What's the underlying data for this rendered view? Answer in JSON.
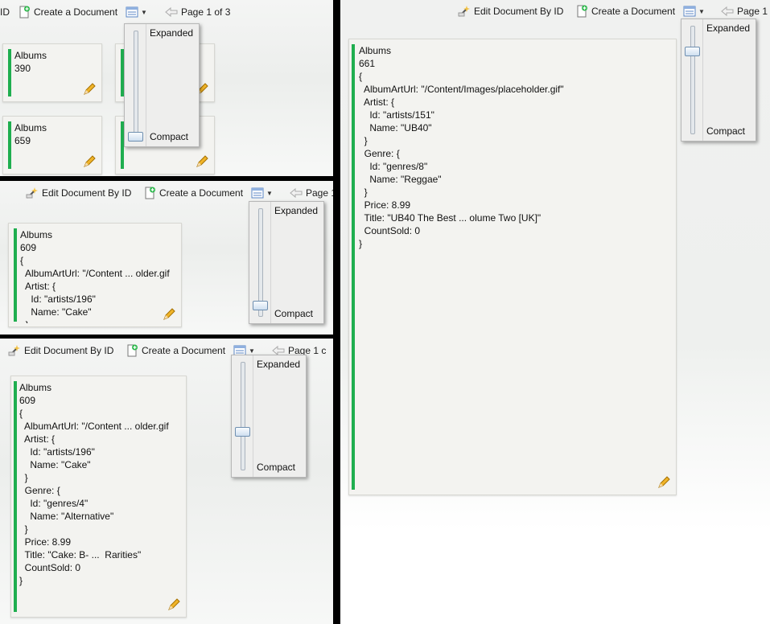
{
  "toolbar": {
    "edit_label": "Edit Document By ID",
    "edit_label_cut": "ID",
    "create_label": "Create a Document",
    "page_label_full": "Page 1 of 3",
    "page_label_1": "Page 1",
    "page_label_2": "Page 1 c"
  },
  "density": {
    "top": "Expanded",
    "bottom": "Compact"
  },
  "icons": {
    "edit": "wand-icon",
    "create": "new-document-icon",
    "view": "list-view-icon",
    "prev": "back-arrow-icon",
    "card_edit": "pencil-icon"
  },
  "colors": {
    "card_bar": "#1fae4f",
    "card_bg": "#f3f3f0"
  },
  "panel_a": {
    "cards": [
      {
        "collection": "Albums",
        "id": "390"
      },
      {
        "collection": "Albums",
        "id": "659"
      }
    ]
  },
  "panel_b": {
    "collection": "Albums",
    "id": "609",
    "lines": [
      "{",
      "  AlbumArtUrl: \"/Content ... older.gif",
      "  Artist: {",
      "    Id: \"artists/196\"",
      "    Name: \"Cake\"",
      "  }"
    ]
  },
  "panel_c": {
    "collection": "Albums",
    "id": "609",
    "lines": [
      "{",
      "  AlbumArtUrl: \"/Content ... older.gif",
      "  Artist: {",
      "    Id: \"artists/196\"",
      "    Name: \"Cake\"",
      "  }",
      "  Genre: {",
      "    Id: \"genres/4\"",
      "    Name: \"Alternative\"",
      "  }",
      "  Price: 8.99",
      "  Title: \"Cake: B- ...  Rarities\"",
      "  CountSold: 0",
      "}"
    ]
  },
  "panel_d": {
    "collection": "Albums",
    "id": "661",
    "lines": [
      "{",
      "  AlbumArtUrl: \"/Content/Images/placeholder.gif\"",
      "  Artist: {",
      "    Id: \"artists/151\"",
      "    Name: \"UB40\"",
      "  }",
      "  Genre: {",
      "    Id: \"genres/8\"",
      "    Name: \"Reggae\"",
      "  }",
      "  Price: 8.99",
      "  Title: \"UB40 The Best ... olume Two [UK]\"",
      "  CountSold: 0",
      "}"
    ]
  }
}
